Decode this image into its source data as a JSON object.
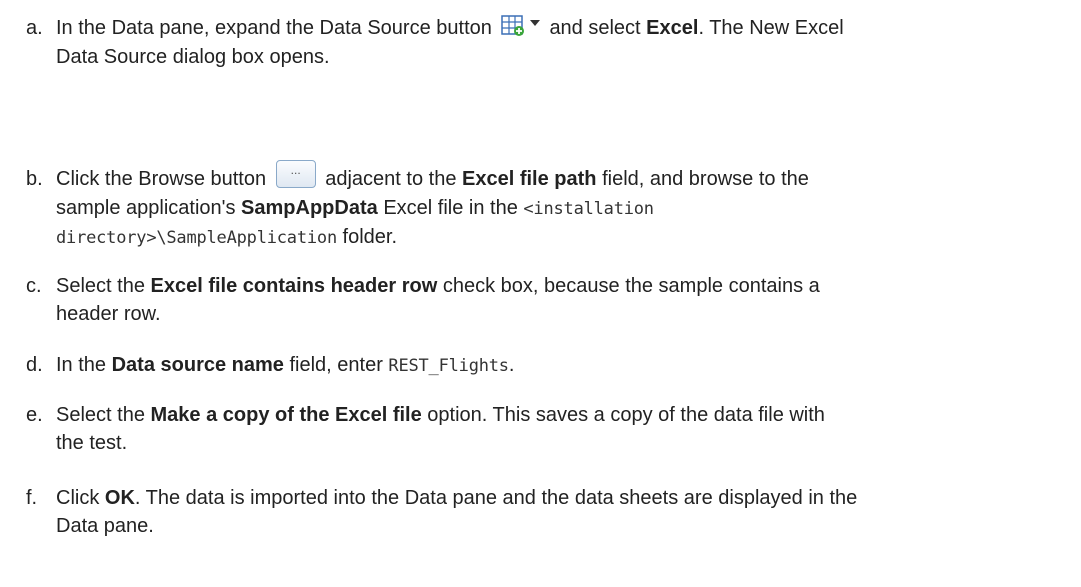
{
  "steps": [
    {
      "letter": "a.",
      "line1": {
        "t1": "In the Data pane, expand the Data Source button",
        "t2": "and select",
        "b1": "Excel",
        "t3": ". The New Excel"
      },
      "line2": "Data Source dialog box opens."
    },
    {
      "letter": "b.",
      "browse_label": "...",
      "line1": {
        "t1": "Click the Browse button",
        "t2": "adjacent to the",
        "b1": "Excel file path",
        "t3": "field, and browse to the"
      },
      "line2": {
        "t1": "sample application's",
        "b1": "SampAppData",
        "t2": "Excel file in the",
        "m1": "<installation"
      },
      "line3": {
        "m1": "directory>\\SampleApplication",
        "t1": "folder."
      }
    },
    {
      "letter": "c.",
      "line1": {
        "t1": "Select the",
        "b1": "Excel file contains header row",
        "t2": "check box, because the sample contains a"
      },
      "line2": "header row."
    },
    {
      "letter": "d.",
      "line1": {
        "t1": "In the",
        "b1": "Data source name",
        "t2": "field, enter",
        "m1": "REST_Flights",
        "t3": "."
      }
    },
    {
      "letter": "e.",
      "line1": {
        "t1": "Select the",
        "b1": "Make a copy of the Excel file",
        "t2": "option. This saves a copy of the data file with"
      },
      "line2": "the test."
    },
    {
      "letter": "f.",
      "line1": {
        "t1": "Click",
        "b1": "OK",
        "t2": ". The data is imported into the Data pane and the data sheets are displayed in the"
      },
      "line2": "Data pane."
    }
  ],
  "icons": {
    "data_source": "data-source-grid-plus-icon",
    "dropdown": "dropdown-arrow-icon",
    "browse": "browse-ellipsis-button"
  },
  "colors": {
    "text": "#222222",
    "grid_icon_blue": "#3b6fb6",
    "plus_green": "#3aa53a",
    "browse_border": "#8aa9c9"
  }
}
